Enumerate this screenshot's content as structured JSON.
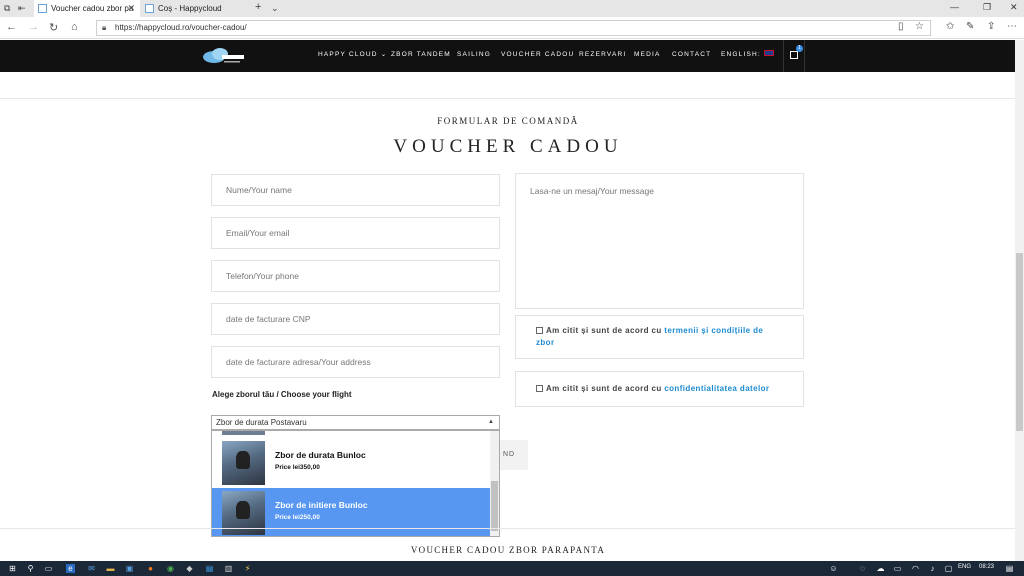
{
  "browser": {
    "tabs": [
      {
        "title": "Voucher cadou zbor pa"
      },
      {
        "title": "Coș - Happycloud"
      }
    ],
    "new_tab_symbol": "+",
    "url": "https://happycloud.ro/voucher-cadou/"
  },
  "site": {
    "nav": [
      {
        "label": "HAPPY CLOUD"
      },
      {
        "label": "ZBOR TANDEM"
      },
      {
        "label": "SAILING"
      },
      {
        "label": "VOUCHER CADOU"
      },
      {
        "label": "REZERVARI"
      },
      {
        "label": "MEDIA"
      },
      {
        "label": "CONTACT"
      },
      {
        "label": "ENGLISH:"
      }
    ],
    "cart_count": "1"
  },
  "form": {
    "subtitle": "FORMULAR DE COMANDĂ",
    "title": "VOUCHER CADOU",
    "fields": {
      "name": "Nume/Your name",
      "email": "Email/Your email",
      "phone": "Telefon/Your phone",
      "cnp": "date de facturare CNP",
      "address": "date de facturare adresa/Your address",
      "message": "Lasa-ne un mesaj/Your message"
    },
    "terms": {
      "prefix": "Am citit și sunt de acord cu ",
      "link": "termenii și condițiile de zbor"
    },
    "privacy": {
      "prefix": "Am citit și sunt de acord cu ",
      "link": "confidentialitatea datelor"
    },
    "choose_label": "Alege zborul tău / Choose your flight",
    "select_value": "Zbor de durata Postavaru",
    "send_label": "ND",
    "options": [
      {
        "name": "Zbor de durata Bunloc",
        "price": "Price lei350,00",
        "selected": false
      },
      {
        "name": "Zbor de initiere Bunloc",
        "price": "Price lei250,00",
        "selected": true
      }
    ]
  },
  "footer": {
    "title": "VOUCHER CADOU ZBOR PARAPANTA"
  },
  "taskbar": {
    "lang": "ENG",
    "time": "08:23"
  },
  "colors": {
    "header_bg": "#111111",
    "link": "#1d8bd1",
    "selected_option": "#5797f2",
    "taskbar": "#1b2838"
  }
}
